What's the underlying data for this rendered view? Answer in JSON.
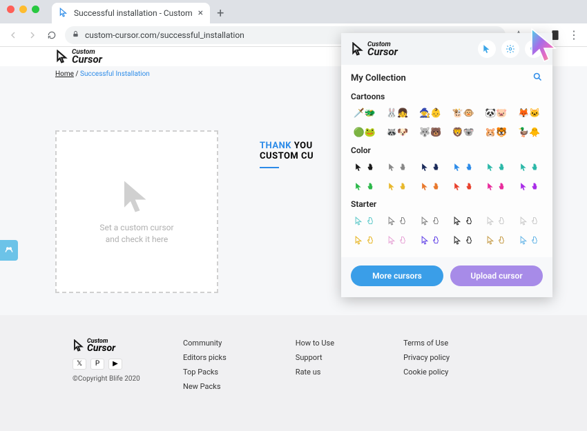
{
  "tab": {
    "title": "Successful installation - Custom"
  },
  "url": "custom-cursor.com/successful_installation",
  "logo": {
    "top": "Custom",
    "bottom": "Cursor"
  },
  "breadcrumb": {
    "home": "Home",
    "sep": " / ",
    "current": "Successful Installation"
  },
  "test_area": {
    "line1": "Set a custom cursor",
    "line2": "and check it here"
  },
  "thank": {
    "part1": "THANK",
    "part2": " YOU",
    "line2": "CUSTOM CU"
  },
  "popup": {
    "collection_title": "My Collection",
    "cat1": "Cartoons",
    "cat2": "Color",
    "cat3": "Starter",
    "btn_more": "More cursors",
    "btn_upload": "Upload cursor"
  },
  "footer": {
    "copyright": "©Copyright Blife 2020",
    "col1": [
      "Community",
      "Editors picks",
      "Top Packs",
      "New Packs"
    ],
    "col2": [
      "How to Use",
      "Support",
      "Rate us"
    ],
    "col3": [
      "Terms of Use",
      "Privacy policy",
      "Cookie policy"
    ]
  },
  "colors": {
    "black": "#1a1a1a",
    "grey": "#888",
    "navy": "#1a2a5a",
    "blue": "#2c8be8",
    "teal": "#2cb8a8",
    "green": "#2cb84a",
    "yellow": "#e8b82c",
    "orange": "#e8782c",
    "red": "#e8402c",
    "pink": "#e82c9c",
    "purple": "#a82ce8"
  }
}
